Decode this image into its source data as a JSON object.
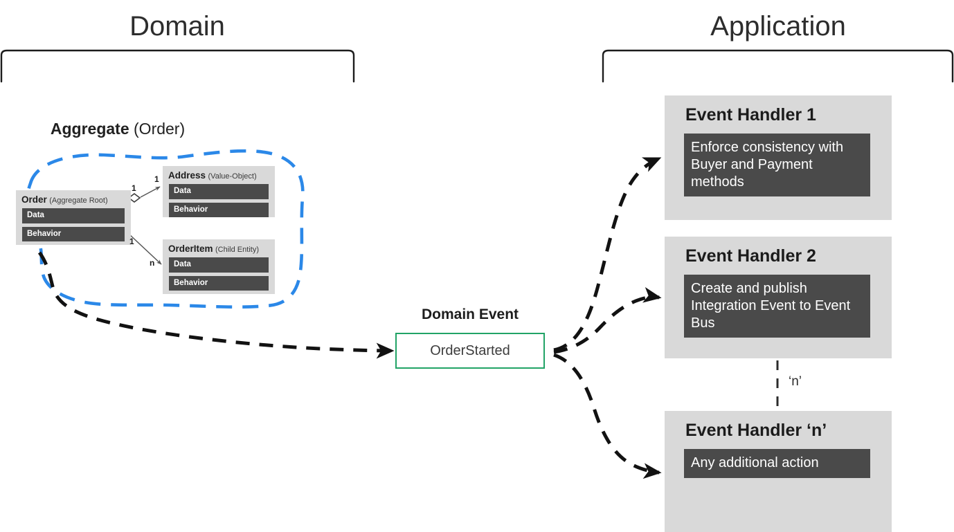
{
  "sections": {
    "domain": {
      "title": "Domain"
    },
    "application": {
      "title": "Application"
    }
  },
  "aggregate": {
    "caption_bold": "Aggregate",
    "caption_rest": " (Order)",
    "boundary_color": "#2b88e8",
    "entities": [
      {
        "name": "Order",
        "stereotype": "(Aggregate Root)",
        "bands": [
          "Data",
          "Behavior"
        ]
      },
      {
        "name": "Address",
        "stereotype": "(Value-Object)",
        "bands": [
          "Data",
          "Behavior"
        ]
      },
      {
        "name": "OrderItem",
        "stereotype": "(Child Entity)",
        "bands": [
          "Data",
          "Behavior"
        ]
      }
    ],
    "multiplicities": {
      "order_to_address_source": "1",
      "order_to_address_target": "1",
      "order_to_orderitem_source": "1",
      "order_to_orderitem_target": "n"
    }
  },
  "domain_event": {
    "label": "Domain Event",
    "name": "OrderStarted",
    "border_color": "#21a366"
  },
  "handlers": [
    {
      "title": "Event Handler 1",
      "body": "Enforce consistency with Buyer and Payment methods"
    },
    {
      "title": "Event Handler 2",
      "body": "Create and publish Integration Event to Event Bus"
    },
    {
      "title": "Event Handler ‘n’",
      "body": "Any additional action"
    }
  ],
  "n_link_label": "‘n’",
  "colors": {
    "panel_gray": "#d9d9d9",
    "band_dark": "#4a4a4a",
    "aggregate_blue": "#2b88e8",
    "event_green": "#21a366",
    "arrow_black": "#121212",
    "uml_arrow_gray": "#565656",
    "text_dark": "#262626"
  }
}
